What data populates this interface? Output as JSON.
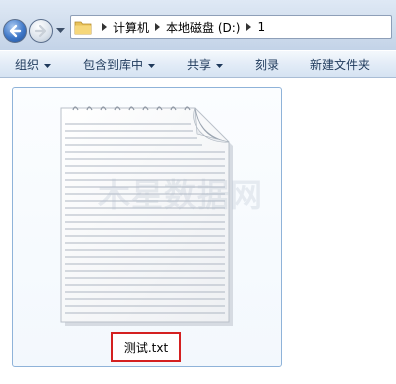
{
  "breadcrumb": {
    "items": [
      "计算机",
      "本地磁盘 (D:)",
      "1"
    ]
  },
  "toolbar": {
    "organize": "组织",
    "include_in_library": "包含到库中",
    "share": "共享",
    "burn": "刻录",
    "new_folder": "新建文件夹"
  },
  "file": {
    "name": "测试.txt",
    "icon": "text-document-icon"
  },
  "watermark": {
    "text": "木星数据网"
  },
  "colors": {
    "highlight_border": "#d42020",
    "toolbar_text": "#1e395b",
    "frame_border": "#8fb3d9"
  }
}
